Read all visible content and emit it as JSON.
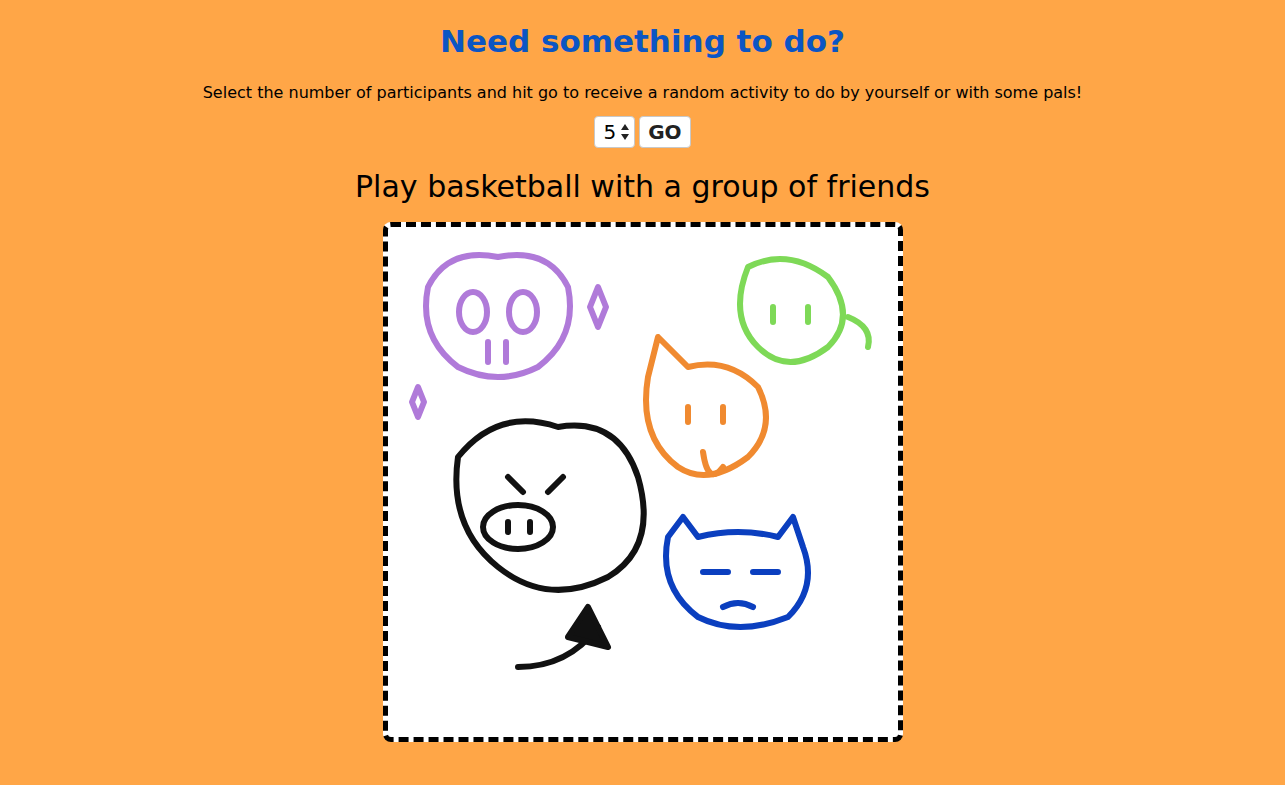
{
  "page": {
    "title": "Need something to do?",
    "subtitle": "Select the number of participants and hit go to receive a random activity to do by yourself or with some pals!"
  },
  "form": {
    "participants": "5",
    "button": "GO"
  },
  "activity": {
    "text": "Play basketball with a group of friends"
  }
}
